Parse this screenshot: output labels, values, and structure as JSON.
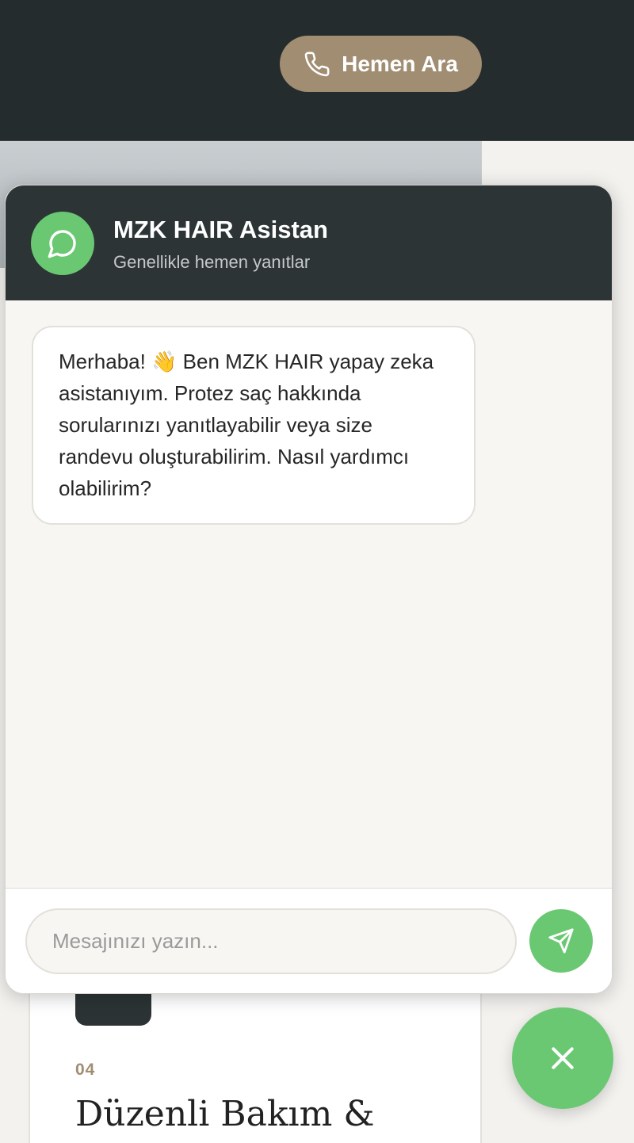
{
  "header": {
    "call_button_label": "Hemen Ara",
    "call_icon": "phone-icon"
  },
  "background_card": {
    "number": "04",
    "title": "Düzenli Bakım &"
  },
  "chat": {
    "title": "MZK HAIR Asistan",
    "subtitle": "Genellikle hemen yanıtlar",
    "avatar_icon": "chat-bubble-icon",
    "messages": [
      {
        "sender": "bot",
        "text": "Merhaba! 👋 Ben MZK HAIR yapay zeka asistanıyım. Protez saç hakkında sorularınızı yanıtlayabilir veya size randevu oluşturabilirim. Nasıl yardımcı olabilirim?"
      }
    ],
    "input": {
      "value": "",
      "placeholder": "Mesajınızı yazın..."
    },
    "send_icon": "send-icon",
    "close_icon": "close-icon"
  },
  "colors": {
    "header_bg": "#252c2d",
    "call_button_bg": "#a08d72",
    "accent_green": "#6ac872",
    "chat_header_bg": "#2c3436",
    "chat_body_bg": "#f7f6f3"
  }
}
